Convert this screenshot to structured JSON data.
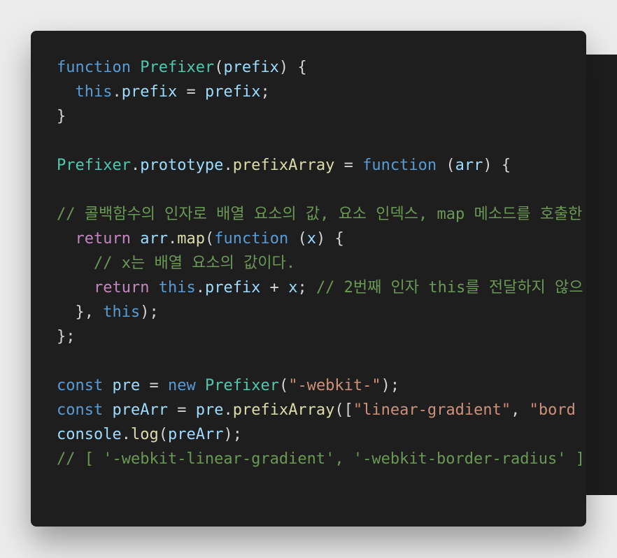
{
  "code_lines": [
    [
      [
        "kw",
        "function"
      ],
      [
        "pun",
        " "
      ],
      [
        "cls",
        "Prefixer"
      ],
      [
        "pun",
        "("
      ],
      [
        "var",
        "prefix"
      ],
      [
        "pun",
        ") {"
      ]
    ],
    [
      [
        "pun",
        "  "
      ],
      [
        "kw",
        "this"
      ],
      [
        "pun",
        "."
      ],
      [
        "var",
        "prefix"
      ],
      [
        "pun",
        " = "
      ],
      [
        "var",
        "prefix"
      ],
      [
        "pun",
        ";"
      ]
    ],
    [
      [
        "pun",
        "}"
      ]
    ],
    [],
    [
      [
        "cls",
        "Prefixer"
      ],
      [
        "pun",
        "."
      ],
      [
        "var",
        "prototype"
      ],
      [
        "pun",
        "."
      ],
      [
        "fn",
        "prefixArray"
      ],
      [
        "pun",
        " = "
      ],
      [
        "kw",
        "function"
      ],
      [
        "pun",
        " ("
      ],
      [
        "var",
        "arr"
      ],
      [
        "pun",
        ") {"
      ]
    ],
    [],
    [
      [
        "com",
        "// 콜백함수의 인자로 배열 요소의 값, 요소 인덱스, map 메소드를 호출한 배"
      ]
    ],
    [
      [
        "pun",
        "  "
      ],
      [
        "ctl",
        "return"
      ],
      [
        "pun",
        " "
      ],
      [
        "var",
        "arr"
      ],
      [
        "pun",
        "."
      ],
      [
        "fn",
        "map"
      ],
      [
        "pun",
        "("
      ],
      [
        "kw",
        "function"
      ],
      [
        "pun",
        " ("
      ],
      [
        "var",
        "x"
      ],
      [
        "pun",
        ") {"
      ]
    ],
    [
      [
        "pun",
        "    "
      ],
      [
        "com",
        "// x는 배열 요소의 값이다."
      ]
    ],
    [
      [
        "pun",
        "    "
      ],
      [
        "ctl",
        "return"
      ],
      [
        "pun",
        " "
      ],
      [
        "kw",
        "this"
      ],
      [
        "pun",
        "."
      ],
      [
        "var",
        "prefix"
      ],
      [
        "pun",
        " + "
      ],
      [
        "var",
        "x"
      ],
      [
        "pun",
        "; "
      ],
      [
        "com",
        "// 2번째 인자 this를 전달하지 않으"
      ]
    ],
    [
      [
        "pun",
        "  }, "
      ],
      [
        "kw",
        "this"
      ],
      [
        "pun",
        ");"
      ]
    ],
    [
      [
        "pun",
        "};"
      ]
    ],
    [],
    [
      [
        "kw",
        "const"
      ],
      [
        "pun",
        " "
      ],
      [
        "var",
        "pre"
      ],
      [
        "pun",
        " = "
      ],
      [
        "kw",
        "new"
      ],
      [
        "pun",
        " "
      ],
      [
        "cls",
        "Prefixer"
      ],
      [
        "pun",
        "("
      ],
      [
        "str",
        "\"-webkit-\""
      ],
      [
        "pun",
        ");"
      ]
    ],
    [
      [
        "kw",
        "const"
      ],
      [
        "pun",
        " "
      ],
      [
        "var",
        "preArr"
      ],
      [
        "pun",
        " = "
      ],
      [
        "var",
        "pre"
      ],
      [
        "pun",
        "."
      ],
      [
        "fn",
        "prefixArray"
      ],
      [
        "pun",
        "(["
      ],
      [
        "str",
        "\"linear-gradient\""
      ],
      [
        "pun",
        ", "
      ],
      [
        "str",
        "\"bord"
      ]
    ],
    [
      [
        "var",
        "console"
      ],
      [
        "pun",
        "."
      ],
      [
        "fn",
        "log"
      ],
      [
        "pun",
        "("
      ],
      [
        "var",
        "preArr"
      ],
      [
        "pun",
        ");"
      ]
    ],
    [
      [
        "com",
        "// [ '-webkit-linear-gradient', '-webkit-border-radius' ]"
      ]
    ]
  ],
  "theme": {
    "background": "#1e1e1e",
    "keyword": "#569cd6",
    "control": "#c586c0",
    "class": "#4ec9b0",
    "function": "#dcdcaa",
    "variable": "#9cdcfe",
    "string": "#ce9178",
    "comment": "#6a9955",
    "text": "#d4d4d4"
  }
}
